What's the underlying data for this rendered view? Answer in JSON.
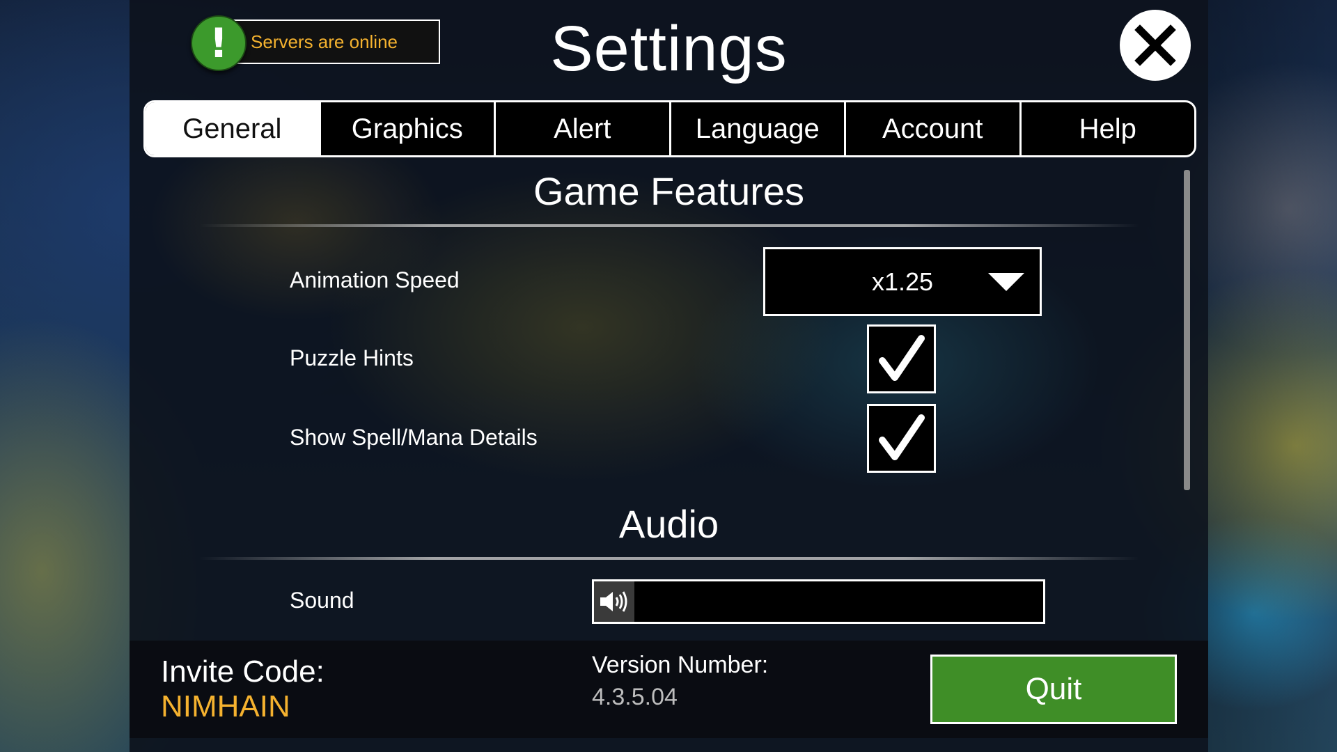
{
  "header": {
    "status_text": "Servers are online",
    "status_icon": "exclamation-icon",
    "title": "Settings",
    "close_icon": "close-icon"
  },
  "tabs": [
    {
      "label": "General",
      "active": true
    },
    {
      "label": "Graphics",
      "active": false
    },
    {
      "label": "Alert",
      "active": false
    },
    {
      "label": "Language",
      "active": false
    },
    {
      "label": "Account",
      "active": false
    },
    {
      "label": "Help",
      "active": false
    }
  ],
  "game_features": {
    "title": "Game Features",
    "animation_speed": {
      "label": "Animation Speed",
      "value": "x1.25"
    },
    "puzzle_hints": {
      "label": "Puzzle Hints",
      "checked": true
    },
    "spell_mana_details": {
      "label": "Show Spell/Mana Details",
      "checked": true
    }
  },
  "audio": {
    "title": "Audio",
    "sound": {
      "label": "Sound",
      "icon": "speaker-icon",
      "level": 0.09
    }
  },
  "footer": {
    "invite_label": "Invite Code:",
    "invite_code": "NIMHAIN",
    "version_label": "Version Number:",
    "version_value": "4.3.5.04",
    "quit_label": "Quit"
  },
  "colors": {
    "accent_gold": "#f5b22f",
    "quit_green": "#3f8e27",
    "status_green": "#3c9a2c"
  }
}
